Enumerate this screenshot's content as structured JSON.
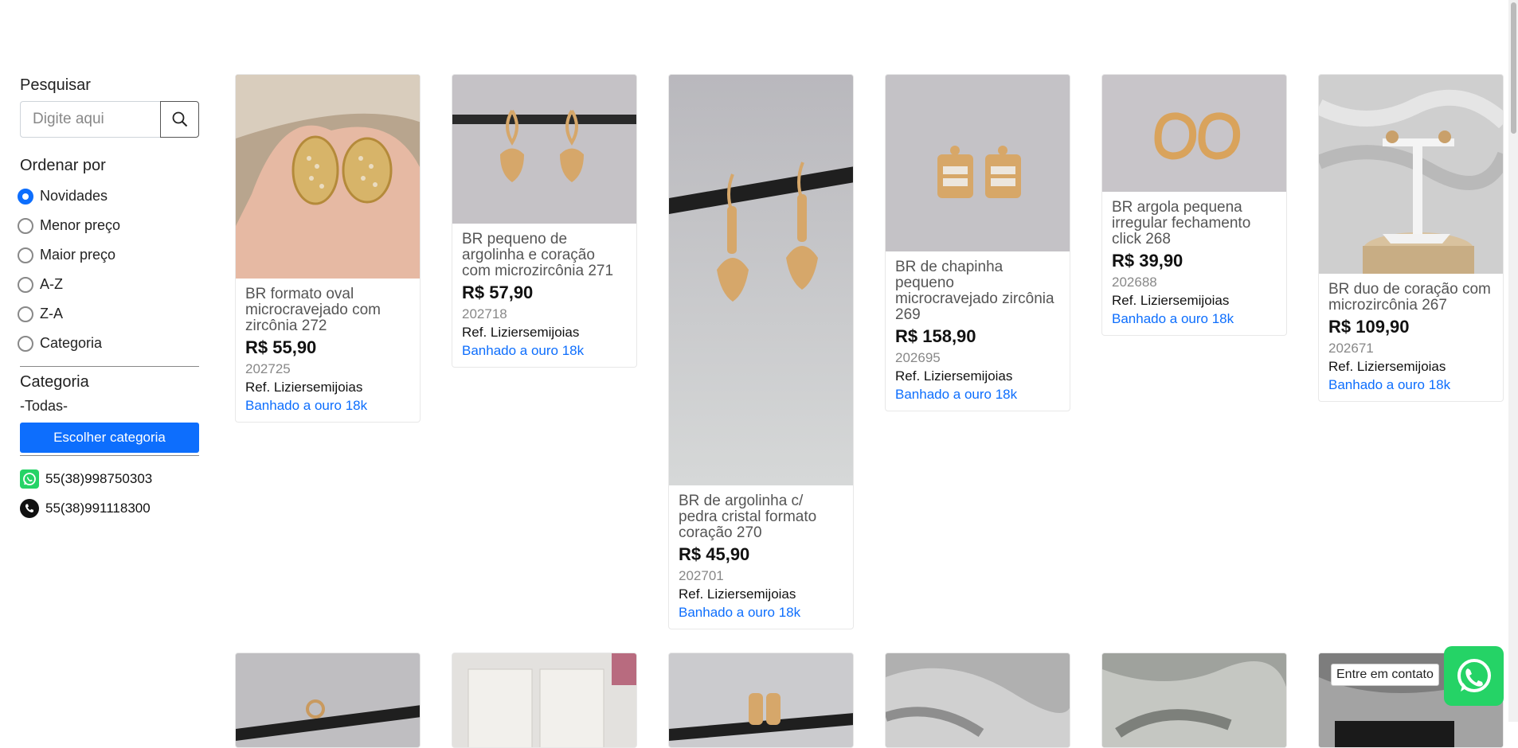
{
  "sidebar": {
    "search_heading": "Pesquisar",
    "search_placeholder": "Digite aqui",
    "sort_heading": "Ordenar por",
    "sort_options": [
      {
        "label": "Novidades",
        "checked": true
      },
      {
        "label": "Menor preço",
        "checked": false
      },
      {
        "label": "Maior preço",
        "checked": false
      },
      {
        "label": "A-Z",
        "checked": false
      },
      {
        "label": "Z-A",
        "checked": false
      },
      {
        "label": "Categoria",
        "checked": false
      }
    ],
    "category_heading": "Categoria",
    "category_value": "-Todas-",
    "category_button": "Escolher categoria",
    "whatsapp_phone": "55(38)998750303",
    "phone": "55(38)991118300"
  },
  "products": [
    {
      "title": "BR formato oval microcravejado com zircônia 272",
      "price": "R$ 55,90",
      "code": "202725",
      "ref": "Ref. Liziersemijoias",
      "tag": "Banhado a ouro 18k"
    },
    {
      "title": "BR pequeno de argolinha e coração com microzircônia 271",
      "price": "R$ 57,90",
      "code": "202718",
      "ref": "Ref. Liziersemijoias",
      "tag": "Banhado a ouro 18k"
    },
    {
      "title": "BR de argolinha c/ pedra cristal formato coração 270",
      "price": "R$ 45,90",
      "code": "202701",
      "ref": "Ref. Liziersemijoias",
      "tag": "Banhado a ouro 18k"
    },
    {
      "title": "BR de chapinha pequeno microcravejado zircônia 269",
      "price": "R$ 158,90",
      "code": "202695",
      "ref": "Ref. Liziersemijoias",
      "tag": "Banhado a ouro 18k"
    },
    {
      "title": "BR argola pequena irregular fechamento click 268",
      "price": "R$ 39,90",
      "code": "202688",
      "ref": "Ref. Liziersemijoias",
      "tag": "Banhado a ouro 18k"
    },
    {
      "title": "BR duo de coração com microzircônia 267",
      "price": "R$ 109,90",
      "code": "202671",
      "ref": "Ref. Liziersemijoias",
      "tag": "Banhado a ouro 18k"
    }
  ],
  "floating": {
    "tooltip": "Entre em contato"
  },
  "colors": {
    "accent": "#0d6efd",
    "whatsapp": "#25d366"
  }
}
